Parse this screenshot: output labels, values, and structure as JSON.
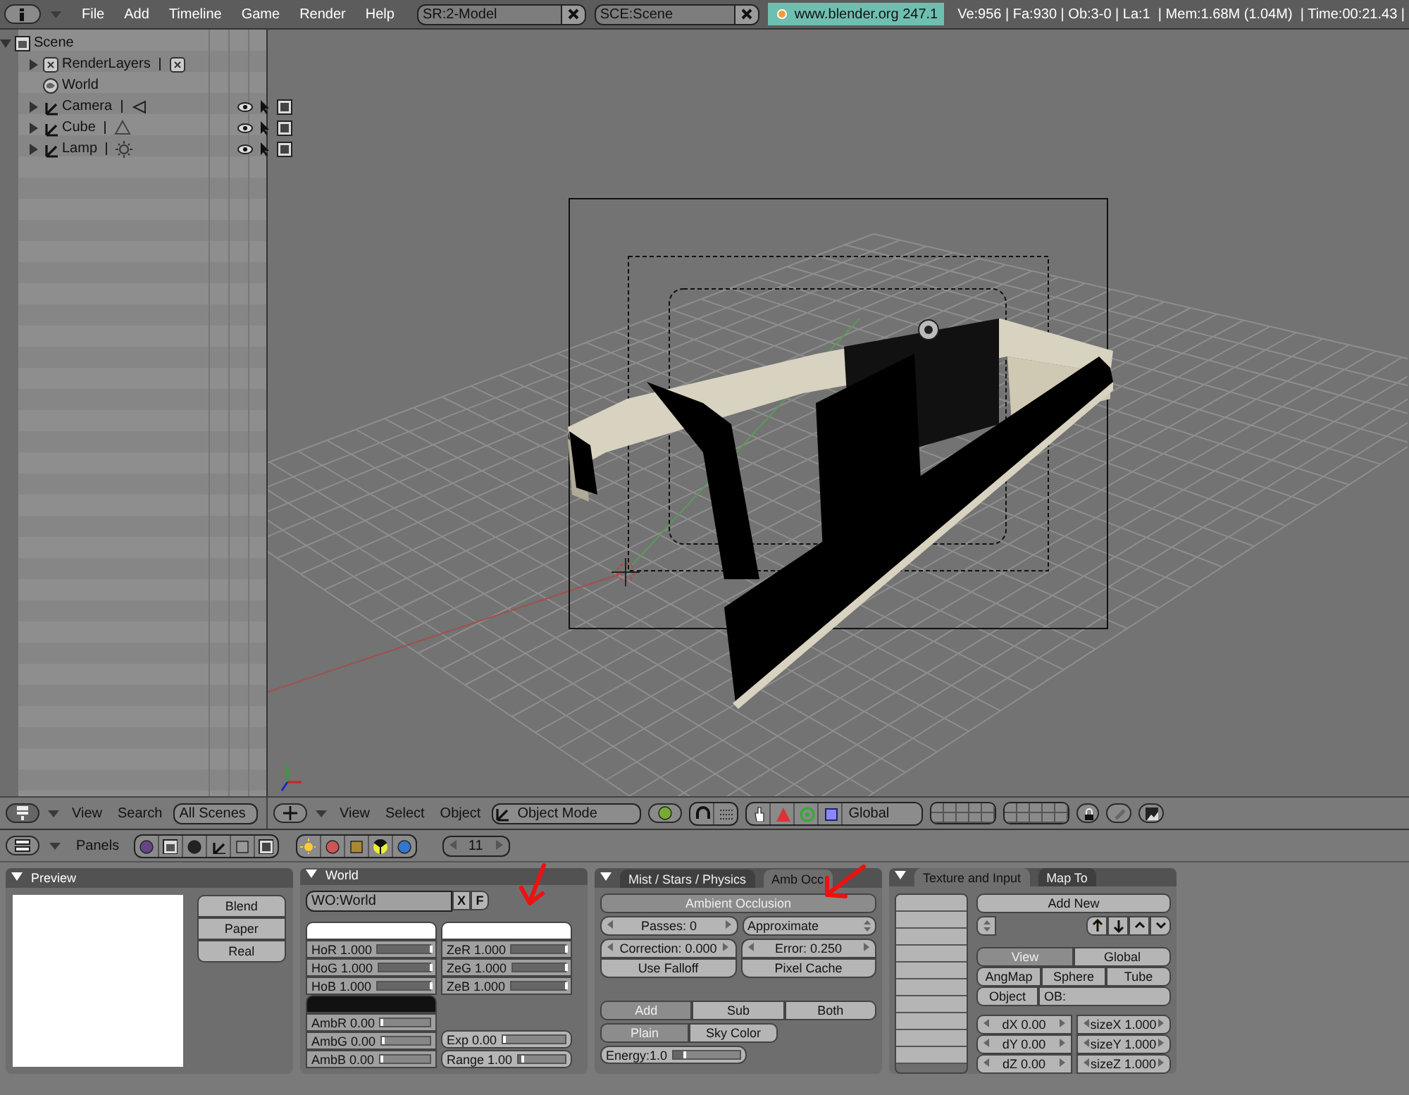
{
  "top_bar": {
    "menus": [
      "File",
      "Add",
      "Timeline",
      "Game",
      "Render",
      "Help"
    ],
    "screen_field": "SR:2-Model",
    "scene_field": "SCE:Scene",
    "version": "www.blender.org 247.1",
    "stats": "Ve:956 | Fa:930 | Ob:3-0 | La:1  | Mem:1.68M (1.04M)  | Time:00:21.43 |"
  },
  "outliner": {
    "tree": [
      {
        "label": "Scene",
        "kind": "scene",
        "expanded": true,
        "children": [
          {
            "label": "RenderLayers",
            "kind": "renderlayers",
            "expanded": false
          },
          {
            "label": "World",
            "kind": "world"
          },
          {
            "label": "Camera",
            "kind": "camera",
            "expanded": false
          },
          {
            "label": "Cube",
            "kind": "mesh",
            "expanded": false
          },
          {
            "label": "Lamp",
            "kind": "lamp",
            "expanded": false
          }
        ]
      }
    ]
  },
  "outliner_header": {
    "menus": [
      "View",
      "Search"
    ],
    "scope": "All Scenes"
  },
  "viewport_header": {
    "menus": [
      "View",
      "Select",
      "Object"
    ],
    "mode": "Object Mode",
    "orientation": "Global"
  },
  "buttons_header": {
    "menu": "Panels",
    "frame": "11"
  },
  "panels": [
    {
      "kind": "preview",
      "title": "Preview",
      "buttons": [
        {
          "label": "Blend",
          "selected": false
        },
        {
          "label": "Paper",
          "selected": false
        },
        {
          "label": "Real",
          "selected": false
        }
      ]
    },
    {
      "kind": "world",
      "title": "World",
      "name_field": "WO:World",
      "buttons": [
        "X",
        "F"
      ],
      "swatches": [
        {
          "color": "#ffffff",
          "sliders": [
            {
              "label": "HoR 1.000",
              "level": 1
            },
            {
              "label": "HoG 1.000",
              "level": 1
            },
            {
              "label": "HoB 1.000",
              "level": 1
            }
          ]
        },
        {
          "color": "#ffffff",
          "sliders": [
            {
              "label": "ZeR 1.000",
              "level": 1
            },
            {
              "label": "ZeG 1.000",
              "level": 1
            },
            {
              "label": "ZeB 1.000",
              "level": 1
            }
          ]
        },
        {
          "color": "#111111",
          "sliders": [
            {
              "label": "AmbR 0.00",
              "level": 0
            },
            {
              "label": "AmbG 0.00",
              "level": 0
            },
            {
              "label": "AmbB 0.00",
              "level": 0
            }
          ]
        }
      ],
      "exposure": [
        {
          "label": "Exp 0.00",
          "level": 0
        },
        {
          "label": "Range 1.00",
          "level": 0.08
        }
      ]
    },
    {
      "kind": "ambocc",
      "tabs": [
        {
          "label": "Mist / Stars / Physics",
          "selected": false
        },
        {
          "label": "Amb Occ",
          "selected": true
        }
      ],
      "toggle": {
        "label": "Ambient Occlusion",
        "on": true
      },
      "passes": "Passes: 0",
      "method": "Approximate",
      "correction": "Correction: 0.000",
      "error": "Error: 0.250",
      "toggles": [
        {
          "label": "Use Falloff",
          "on": false
        },
        {
          "label": "Pixel Cache",
          "on": false
        }
      ],
      "blend_modes": [
        {
          "label": "Add",
          "selected": true
        },
        {
          "label": "Sub",
          "selected": false
        },
        {
          "label": "Both",
          "selected": false
        }
      ],
      "color_modes": [
        {
          "label": "Plain",
          "selected": true
        },
        {
          "label": "Sky Color",
          "selected": false
        }
      ],
      "energy": {
        "label": "Energy:1.0",
        "level": 0.15
      }
    },
    {
      "kind": "texture",
      "tabs": [
        {
          "label": "Texture and Input",
          "selected": true
        },
        {
          "label": "Map To",
          "selected": false
        }
      ],
      "add_button": "Add New",
      "coords": [
        {
          "label": "View",
          "selected": true
        },
        {
          "label": "Global",
          "selected": false
        }
      ],
      "mapping": [
        {
          "label": "AngMap",
          "selected": false
        },
        {
          "label": "Sphere",
          "selected": false
        },
        {
          "label": "Tube",
          "selected": false
        }
      ],
      "object_button": "Object",
      "object_field": "OB:",
      "offsets": [
        "dX 0.00",
        "dY 0.00",
        "dZ 0.00"
      ],
      "sizes": [
        "sizeX 1.000",
        "sizeY 1.000",
        "sizeZ 1.000"
      ]
    }
  ]
}
